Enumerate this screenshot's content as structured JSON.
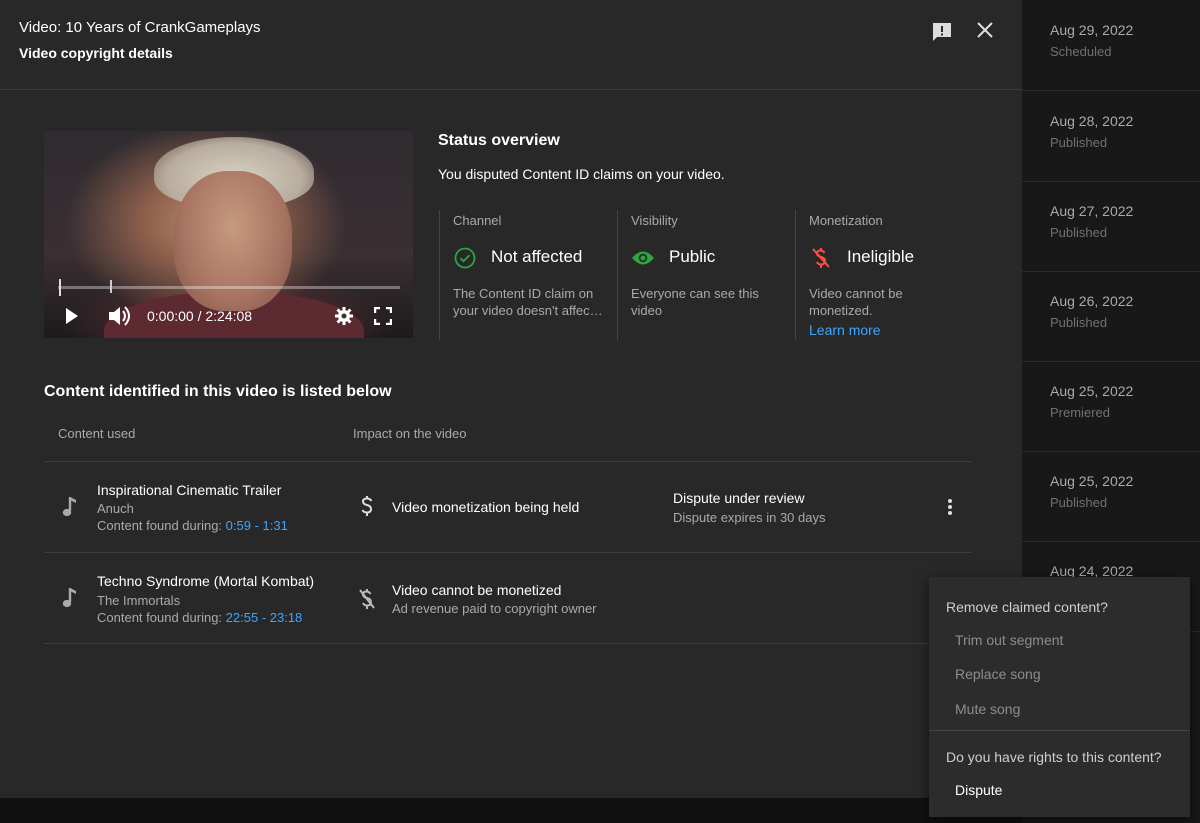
{
  "dialog": {
    "title": "Video: 10 Years of CrankGameplays",
    "subtitle": "Video copyright details",
    "feedback_icon": "feedback-icon",
    "close_icon": "close-icon"
  },
  "player": {
    "time": "0:00:00 / 2:24:08",
    "progress_fraction": 0.0,
    "icons": [
      "play-icon",
      "volume-icon",
      "settings-icon",
      "fullscreen-icon"
    ]
  },
  "status": {
    "title": "Status overview",
    "text": "You disputed Content ID claims on your video.",
    "columns": [
      {
        "label": "Channel",
        "value": "Not affected",
        "icon": "check-circle-icon",
        "desc": "The Content ID claim on your video doesn't affec…",
        "color": "#2ba640"
      },
      {
        "label": "Visibility",
        "value": "Public",
        "icon": "eye-icon",
        "desc": "Everyone can see this video",
        "color": "#2ba640"
      },
      {
        "label": "Monetization",
        "value": "Ineligible",
        "icon": "no-money-icon",
        "desc": "Video cannot be monetized.",
        "link": "Learn more",
        "color": "#ff4e45"
      }
    ]
  },
  "content": {
    "title": "Content identified in this video is listed below",
    "headers": {
      "content_used": "Content used",
      "impact": "Impact on the video"
    },
    "found_label": "Content found during:",
    "items": [
      {
        "title": "Inspirational Cinematic Trailer",
        "artist": "Anuch",
        "range": "0:59 - 1:31",
        "impact": "Video monetization being held",
        "impact_sub": "",
        "dispute_title": "Dispute under review",
        "dispute_sub": "Dispute expires in 30 days"
      },
      {
        "title": "Techno Syndrome (Mortal Kombat)",
        "artist": "The Immortals",
        "range": "22:55 - 23:18",
        "impact": "Video cannot be monetized",
        "impact_sub": "Ad revenue paid to copyright owner"
      }
    ]
  },
  "menu": {
    "remove_heading": "Remove claimed content?",
    "remove_options": [
      "Trim out segment",
      "Replace song",
      "Mute song"
    ],
    "rights_heading": "Do you have rights to this content?",
    "dispute": "Dispute"
  },
  "background_list": [
    {
      "date": "Aug 29, 2022",
      "status": "Scheduled"
    },
    {
      "date": "Aug 28, 2022",
      "status": "Published"
    },
    {
      "date": "Aug 27, 2022",
      "status": "Published"
    },
    {
      "date": "Aug 26, 2022",
      "status": "Published"
    },
    {
      "date": "Aug 25, 2022",
      "status": "Premiered"
    },
    {
      "date": "Aug 25, 2022",
      "status": "Published"
    },
    {
      "date": "Aug 24, 2022",
      "status": ""
    }
  ],
  "colors": {
    "accent_link": "#3ea6ff",
    "ok": "#2ba640",
    "error": "#ff4e45",
    "dialog_bg": "#282828"
  }
}
